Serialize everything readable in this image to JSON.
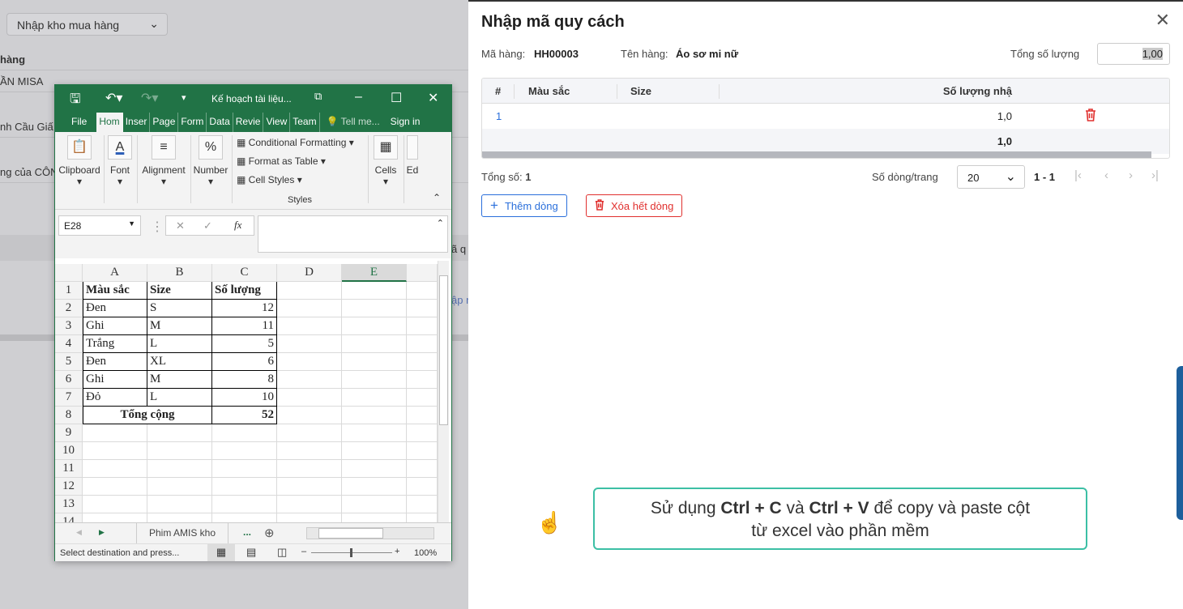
{
  "background": {
    "voucher_type": "Nhập kho mua hàng",
    "texts": [
      "hàng",
      "ẦN MISA",
      "nh Cầu Giấ",
      "ng của CÔN",
      "ã q",
      "ập n"
    ]
  },
  "panel": {
    "title": "Nhập mã quy cách",
    "item_code_label": "Mã hàng:",
    "item_code": "HH00003",
    "item_name_label": "Tên hàng:",
    "item_name": "Áo sơ mi nữ",
    "total_qty_label": "Tổng số lượng",
    "total_qty": "1,00",
    "columns": [
      "#",
      "Màu sắc",
      "Size",
      "Số lượng nhậ"
    ],
    "rows": [
      {
        "no": "1",
        "color": "",
        "size": "",
        "qty": "1,0"
      }
    ],
    "footer_total": "1,0",
    "total_count_label": "Tổng số:",
    "total_count": "1",
    "page_size_label": "Số dòng/trang",
    "page_size": "20",
    "page_range": "1 - 1",
    "add_row": "Thêm dòng",
    "delete_all": "Xóa hết dòng",
    "hint_pre": "Sử dụng ",
    "hint_k1": "Ctrl + C",
    "hint_mid": " và ",
    "hint_k2": "Ctrl + V",
    "hint_post": " để copy và paste cột",
    "hint_line2": "từ excel vào phần mềm",
    "colors": {
      "primary": "#2a6fdb",
      "danger": "#e0302e",
      "callout": "#3cbfa5"
    }
  },
  "excel": {
    "title": "Kế hoạch tài liệu...",
    "tabs": [
      "File",
      "Hom",
      "Inser",
      "Page",
      "Form",
      "Data",
      "Revie",
      "View",
      "Team"
    ],
    "tell_me": "Tell me...",
    "sign_in": "Sign in",
    "groups": {
      "clipboard": "Clipboard",
      "font": "Font",
      "alignment": "Alignment",
      "number": "Number",
      "cond_fmt": "Conditional Formatting",
      "fmt_table": "Format as Table",
      "cell_styles": "Cell Styles",
      "styles": "Styles",
      "cells": "Cells",
      "editing": "Ed"
    },
    "name_box": "E28",
    "columns": [
      "A",
      "B",
      "C",
      "D",
      "E"
    ],
    "cells": [
      [
        "Màu sắc",
        "Size",
        "Số lượng"
      ],
      [
        "Đen",
        "S",
        "12"
      ],
      [
        "Ghi",
        "M",
        "11"
      ],
      [
        "Trắng",
        "L",
        "5"
      ],
      [
        "Đen",
        "XL",
        "6"
      ],
      [
        "Ghi",
        "M",
        "8"
      ],
      [
        "Đỏ",
        "L",
        "10"
      ],
      [
        "Tổng cộng",
        "",
        "52"
      ]
    ],
    "row_numbers": [
      "1",
      "2",
      "3",
      "4",
      "5",
      "6",
      "7",
      "8",
      "9",
      "10",
      "11",
      "12",
      "13",
      "14"
    ],
    "sheet_tab": "Phim AMIS kho",
    "more": "...",
    "status": "Select destination and press...",
    "zoom": "100%",
    "accent": "#217346"
  }
}
